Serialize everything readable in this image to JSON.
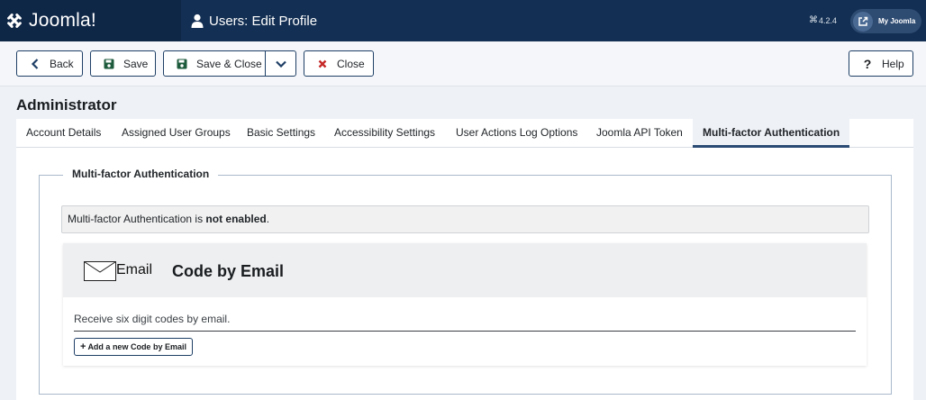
{
  "header": {
    "brand_name": "Joomla!",
    "page_title": "Users: Edit Profile",
    "version": "4.2.4",
    "version_icon": "⌘",
    "my_joomla_label": "My Joomla",
    "colors": {
      "header_bg": "#132f53",
      "brand_bg": "#0f2747",
      "accent": "#2a4b74"
    }
  },
  "toolbar": {
    "back_label": "Back",
    "save_label": "Save",
    "save_close_label": "Save & Close",
    "close_label": "Close",
    "help_label": "Help"
  },
  "main": {
    "title": "Administrator",
    "tabs": [
      {
        "label": "Account Details",
        "active": false
      },
      {
        "label": "Assigned User Groups",
        "active": false
      },
      {
        "label": "Basic Settings",
        "active": false
      },
      {
        "label": "Accessibility Settings",
        "active": false
      },
      {
        "label": "User Actions Log Options",
        "active": false
      },
      {
        "label": "Joomla API Token",
        "active": false
      },
      {
        "label": "Multi-factor Authentication",
        "active": true
      }
    ],
    "mfa": {
      "legend": "Multi-factor Authentication",
      "alert_prefix": "Multi-factor Authentication is ",
      "alert_strong": "not enabled",
      "alert_suffix": ".",
      "method": {
        "icon_alt": "Email",
        "title": "Code by Email",
        "description": "Receive six digit codes by email.",
        "add_button_label": "Add a new Code by Email"
      }
    }
  }
}
